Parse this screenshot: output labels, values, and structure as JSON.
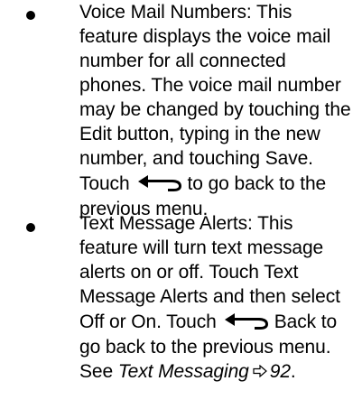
{
  "items": [
    {
      "lines": [
        "Voice Mail Numbers: This",
        "feature displays the voice mail",
        "number for all connected",
        "phones. The voice mail number",
        "may be changed by touching the",
        "Edit button, typing in the new",
        "number, and touching Save."
      ],
      "touch_line_before": "Touch",
      "touch_line_after": "to go back to the",
      "final_line": "previous menu.",
      "arrow_icon": "back-arrow-icon"
    },
    {
      "lines": [
        "Text Message Alerts: This",
        "feature will turn text message",
        "alerts on or off. Touch Text",
        "Message Alerts and then select"
      ],
      "touch_line_before": "Off or On. Touch",
      "touch_line_after": "Back to",
      "after_lines": [
        "go back to the previous menu."
      ],
      "see_prefix": "See",
      "see_link": "Text Messaging",
      "see_page": "92",
      "see_suffix": ".",
      "arrow_icon": "back-arrow-icon",
      "xref_icon": "page-reference-arrow-icon"
    }
  ]
}
